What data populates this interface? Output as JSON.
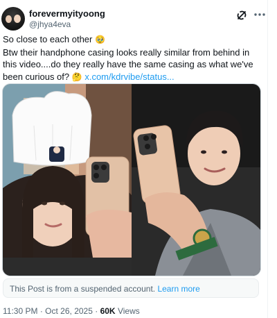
{
  "author": {
    "display_name": "forevermyityoong",
    "handle": "@jhya4eva"
  },
  "tweet": {
    "line1": "So close to each other",
    "line1_emoji": "🥹",
    "line2": "Btw their handphone casing looks really similar from behind in this video....do they really have the same casing as what we've been curious of?",
    "line2_emoji": "🤔",
    "link": "x.com/kdrvibe/status..."
  },
  "notice": {
    "text": "This Post is from a suspended account.",
    "link": "Learn more"
  },
  "meta": {
    "time": "11:30 PM",
    "separator": "·",
    "date": "Oct 26, 2025",
    "views_count": "60K",
    "views_label": "Views"
  },
  "icons": {
    "grok": "grok-icon",
    "more": "more-options-icon"
  },
  "colors": {
    "link": "#1d9bf0",
    "secondary_text": "#536471",
    "primary_text": "#0f1419"
  }
}
